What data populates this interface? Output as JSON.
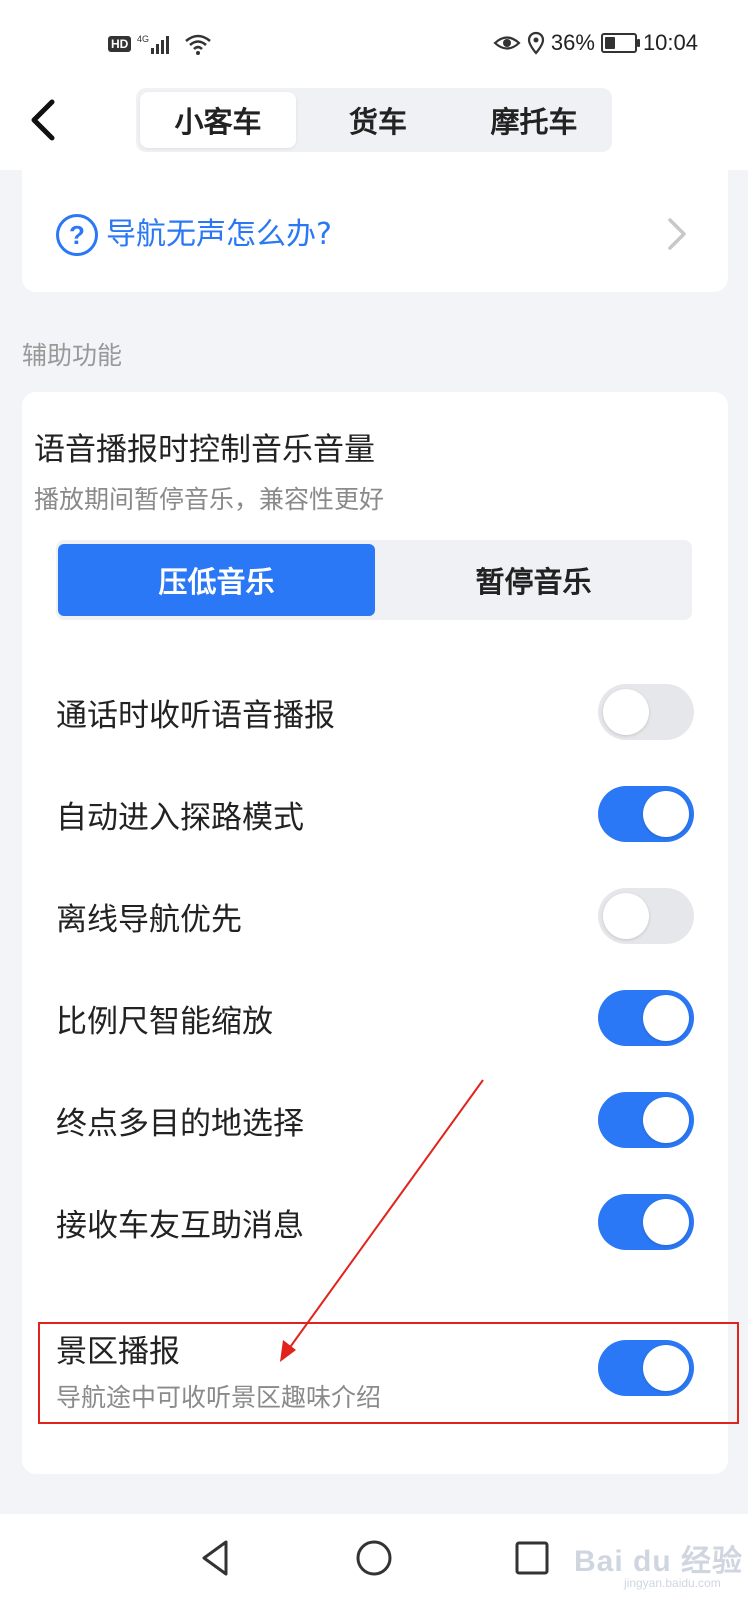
{
  "status_bar": {
    "hd": "HD",
    "network": "4G",
    "battery_percent": "36%",
    "battery_level": 0.36,
    "time": "10:04",
    "icons": [
      "signal-icon",
      "wifi-icon",
      "eye-icon",
      "location-icon",
      "battery-icon"
    ]
  },
  "header": {
    "tabs": [
      {
        "label": "小客车",
        "active": true
      },
      {
        "label": "货车",
        "active": false
      },
      {
        "label": "摩托车",
        "active": false
      }
    ]
  },
  "help": {
    "text": "导航无声怎么办?"
  },
  "section": {
    "title": "辅助功能"
  },
  "volume_control": {
    "title": "语音播报时控制音乐音量",
    "subtitle": "播放期间暂停音乐，兼容性更好",
    "options": [
      {
        "label": "压低音乐",
        "selected": true
      },
      {
        "label": "暂停音乐",
        "selected": false
      }
    ]
  },
  "settings": [
    {
      "label": "通话时收听语音播报",
      "enabled": false
    },
    {
      "label": "自动进入探路模式",
      "enabled": true
    },
    {
      "label": "离线导航优先",
      "enabled": false
    },
    {
      "label": "比例尺智能缩放",
      "enabled": true
    },
    {
      "label": "终点多目的地选择",
      "enabled": true
    },
    {
      "label": "接收车友互助消息",
      "enabled": true
    },
    {
      "label": "景区播报",
      "subtitle": "导航途中可收听景区趣味介绍",
      "enabled": true
    }
  ],
  "colors": {
    "accent": "#2a78f5",
    "annotation": "#e0241b"
  },
  "watermark": {
    "text": "Bai du 经验",
    "sub": "jingyan.baidu.com"
  }
}
